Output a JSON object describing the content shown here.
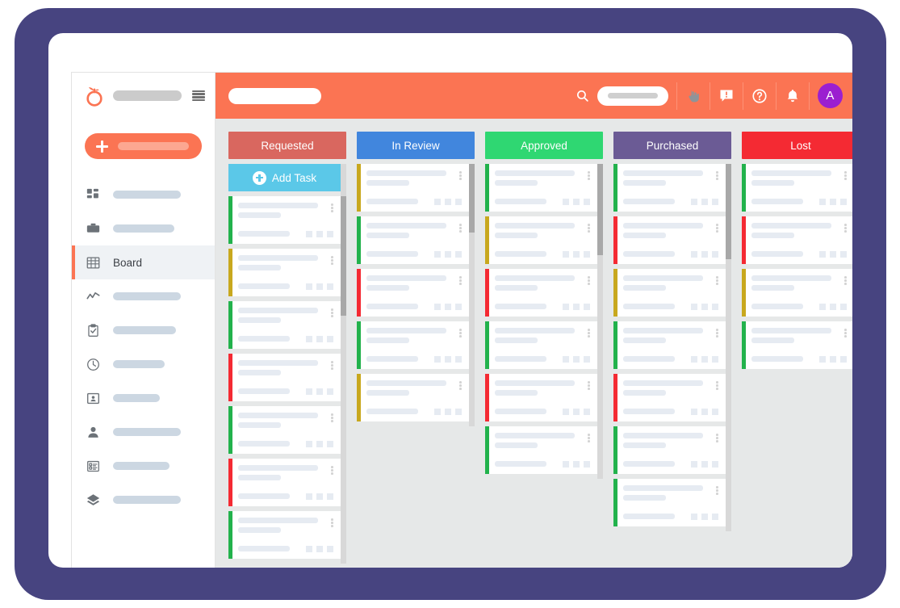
{
  "app": {
    "logo_name": "tomato-logo",
    "brand_color": "#FB7453",
    "board_background": "#e6e8e8",
    "bezel_color": "#474480"
  },
  "sidebar": {
    "new_button": {
      "label": "",
      "icon": "plus-icon"
    },
    "menu_icon": "hamburger-icon",
    "items": [
      {
        "label": "",
        "icon": "dashboard-icon",
        "active": false,
        "pill_width": 84
      },
      {
        "label": "",
        "icon": "briefcase-icon",
        "active": false,
        "pill_width": 76
      },
      {
        "label": "Board",
        "icon": "grid-icon",
        "active": true,
        "pill_width": 0
      },
      {
        "label": "",
        "icon": "chart-line-icon",
        "active": false,
        "pill_width": 84
      },
      {
        "label": "",
        "icon": "clipboard-check-icon",
        "active": false,
        "pill_width": 78
      },
      {
        "label": "",
        "icon": "clock-icon",
        "active": false,
        "pill_width": 64
      },
      {
        "label": "",
        "icon": "id-card-icon",
        "active": false,
        "pill_width": 58
      },
      {
        "label": "",
        "icon": "person-icon",
        "active": false,
        "pill_width": 84
      },
      {
        "label": "",
        "icon": "form-list-icon",
        "active": false,
        "pill_width": 70
      },
      {
        "label": "",
        "icon": "layers-icon",
        "active": false,
        "pill_width": 84
      }
    ]
  },
  "topbar": {
    "title_placeholder": "",
    "search": {
      "icon": "search-icon",
      "value": "",
      "placeholder": ""
    },
    "actions": [
      {
        "name": "cursor-hand-icon",
        "label": ""
      },
      {
        "name": "feedback-icon",
        "label": ""
      },
      {
        "name": "help-icon",
        "label": ""
      },
      {
        "name": "bell-icon",
        "label": ""
      }
    ],
    "avatar": {
      "initial": "A",
      "color": "#9B1FD0"
    }
  },
  "board": {
    "add_task": {
      "label": "Add Task",
      "icon": "add-circle-icon",
      "color": "#5BC8E8"
    },
    "columns": [
      {
        "title": "Requested",
        "color": "#D9675F",
        "has_add_task": true,
        "scroll": {
          "top_pct": 8,
          "height_pct": 30
        },
        "cards": [
          {
            "priority": "green"
          },
          {
            "priority": "yellow"
          },
          {
            "priority": "green"
          },
          {
            "priority": "red"
          },
          {
            "priority": "green"
          },
          {
            "priority": "red"
          },
          {
            "priority": "green"
          }
        ]
      },
      {
        "title": "In Review",
        "color": "#4186DD",
        "has_add_task": false,
        "scroll": {
          "top_pct": 0,
          "height_pct": 26
        },
        "cards": [
          {
            "priority": "yellow"
          },
          {
            "priority": "green"
          },
          {
            "priority": "red"
          },
          {
            "priority": "green"
          },
          {
            "priority": "yellow"
          }
        ]
      },
      {
        "title": "Approved",
        "color": "#2FD772",
        "has_add_task": false,
        "scroll": {
          "top_pct": 0,
          "height_pct": 29
        },
        "cards": [
          {
            "priority": "green"
          },
          {
            "priority": "yellow"
          },
          {
            "priority": "red"
          },
          {
            "priority": "green"
          },
          {
            "priority": "red"
          },
          {
            "priority": "green"
          }
        ]
      },
      {
        "title": "Purchased",
        "color": "#6B5B95",
        "has_add_task": false,
        "scroll": {
          "top_pct": 0,
          "height_pct": 26
        },
        "cards": [
          {
            "priority": "green"
          },
          {
            "priority": "red"
          },
          {
            "priority": "yellow"
          },
          {
            "priority": "green"
          },
          {
            "priority": "red"
          },
          {
            "priority": "green"
          },
          {
            "priority": "green"
          }
        ]
      },
      {
        "title": "Lost",
        "color": "#F42A33",
        "has_add_task": false,
        "scroll": {
          "top_pct": 0,
          "height_pct": 46
        },
        "cards": [
          {
            "priority": "green"
          },
          {
            "priority": "red"
          },
          {
            "priority": "yellow"
          },
          {
            "priority": "green"
          }
        ]
      }
    ],
    "priority_colors": {
      "green": "#22B24C",
      "yellow": "#C8A81E",
      "red": "#F42A33"
    }
  }
}
